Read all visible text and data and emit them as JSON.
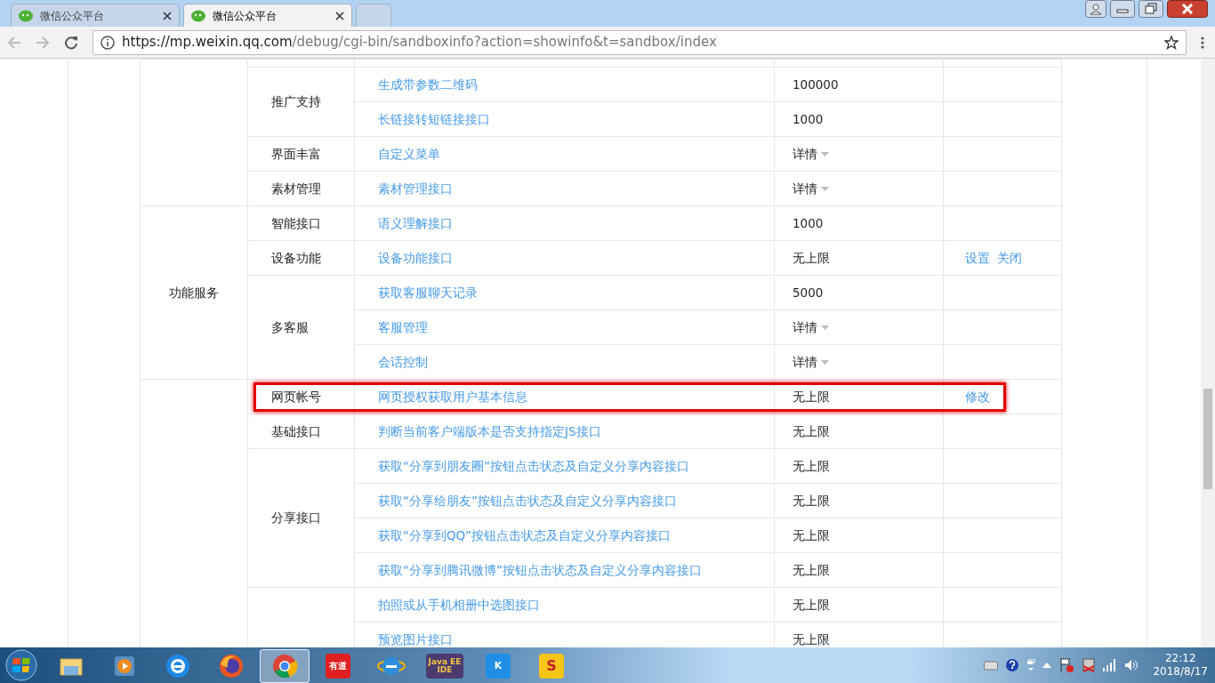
{
  "browser": {
    "tabs": [
      {
        "title": "微信公众平台",
        "selected": false
      },
      {
        "title": "微信公众平台",
        "selected": true
      }
    ],
    "url_host": "https://mp.weixin.qq.com",
    "url_path": "/debug/cgi-bin/sandboxinfo?action=showinfo&t=sandbox/index"
  },
  "table": {
    "groups": [
      {
        "categories": [
          {
            "label": "推广支持",
            "apis": [
              {
                "name": "生成带参数二维码",
                "quota": "100000",
                "kind": "text"
              },
              {
                "name": "长链接转短链接接口",
                "quota": "1000",
                "kind": "text"
              }
            ]
          },
          {
            "label": "界面丰富",
            "apis": [
              {
                "name": "自定义菜单",
                "quota": "详情",
                "kind": "detail"
              }
            ]
          },
          {
            "label": "素材管理",
            "apis": [
              {
                "name": "素材管理接口",
                "quota": "详情",
                "kind": "detail"
              }
            ]
          }
        ]
      },
      {
        "label": "功能服务",
        "categories": [
          {
            "label": "智能接口",
            "apis": [
              {
                "name": "语义理解接口",
                "quota": "1000",
                "kind": "text"
              }
            ]
          },
          {
            "label": "设备功能",
            "apis": [
              {
                "name": "设备功能接口",
                "quota": "无上限",
                "kind": "text",
                "actions": [
                  "设置",
                  "关闭"
                ]
              }
            ]
          },
          {
            "label": "多客服",
            "apis": [
              {
                "name": "获取客服聊天记录",
                "quota": "5000",
                "kind": "text"
              },
              {
                "name": "客服管理",
                "quota": "详情",
                "kind": "detail"
              },
              {
                "name": "会话控制",
                "quota": "详情",
                "kind": "detail"
              }
            ]
          }
        ]
      },
      {
        "categories": [
          {
            "label": "网页帐号",
            "highlighted": true,
            "apis": [
              {
                "name": "网页授权获取用户基本信息",
                "quota": "无上限",
                "kind": "text",
                "actions": [
                  "修改"
                ]
              }
            ]
          },
          {
            "label": "基础接口",
            "apis": [
              {
                "name": "判断当前客户端版本是否支持指定JS接口",
                "quota": "无上限",
                "kind": "text"
              }
            ]
          },
          {
            "label": "分享接口",
            "apis": [
              {
                "name": "获取“分享到朋友圈”按钮点击状态及自定义分享内容接口",
                "quota": "无上限",
                "kind": "text"
              },
              {
                "name": "获取“分享给朋友”按钮点击状态及自定义分享内容接口",
                "quota": "无上限",
                "kind": "text"
              },
              {
                "name": "获取“分享到QQ”按钮点击状态及自定义分享内容接口",
                "quota": "无上限",
                "kind": "text"
              },
              {
                "name": "获取“分享到腾讯微博”按钮点击状态及自定义分享内容接口",
                "quota": "无上限",
                "kind": "text"
              }
            ]
          },
          {
            "apis": [
              {
                "name": "拍照或从手机相册中选图接口",
                "quota": "无上限",
                "kind": "text"
              },
              {
                "name": "预览图片接口",
                "quota": "无上限",
                "kind": "text"
              }
            ]
          }
        ]
      }
    ]
  },
  "taskbar": {
    "items": [
      {
        "kind": "explorer",
        "selected": false
      },
      {
        "kind": "media",
        "selected": false
      },
      {
        "kind": "edge",
        "selected": false
      },
      {
        "kind": "firefox",
        "selected": false
      },
      {
        "kind": "chrome",
        "selected": true
      },
      {
        "kind": "youdao",
        "label": "有道",
        "selected": false
      },
      {
        "kind": "ie",
        "selected": false
      },
      {
        "kind": "javaee",
        "label": "Java EE IDE",
        "selected": false
      },
      {
        "kind": "kugou",
        "label": "K",
        "selected": false
      },
      {
        "kind": "snake",
        "label": "S",
        "selected": false
      }
    ],
    "time": "22:12",
    "date": "2018/8/17"
  }
}
